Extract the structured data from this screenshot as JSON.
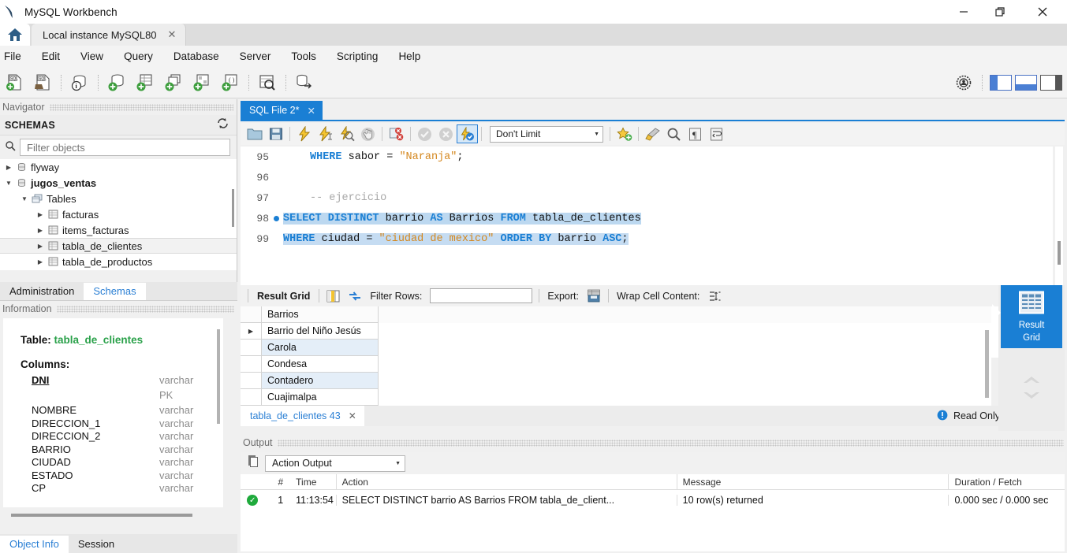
{
  "window": {
    "title": "MySQL Workbench",
    "minimize": "—",
    "maximize": "❐",
    "close": "✕"
  },
  "connection_tab": {
    "label": "Local instance MySQL80",
    "close": "✕"
  },
  "menu": [
    "File",
    "Edit",
    "View",
    "Query",
    "Database",
    "Server",
    "Tools",
    "Scripting",
    "Help"
  ],
  "main_toolbar": {
    "icons": [
      "new-sql-tab-icon",
      "open-sql-script-icon",
      "server-status-icon",
      "new-schema-icon",
      "new-table-icon",
      "new-view-icon",
      "new-procedure-icon",
      "new-function-icon",
      "search-data-icon",
      "reconnect-server-icon"
    ],
    "right_icons": [
      "admin-target-icon",
      "sidebar-left-toggle",
      "sidebar-bottom-toggle",
      "sidebar-right-toggle"
    ]
  },
  "navigator": {
    "caption": "Navigator",
    "schemas_header": "SCHEMAS",
    "refresh_icon": "refresh-icon",
    "filter": {
      "placeholder": "Filter objects",
      "value": "",
      "icon": "search-icon"
    },
    "tree": [
      {
        "label": "flyway",
        "indent": 0,
        "expanded": false,
        "icon": "schema-icon",
        "bold": false,
        "selected": false
      },
      {
        "label": "jugos_ventas",
        "indent": 0,
        "expanded": true,
        "icon": "schema-icon",
        "bold": true,
        "selected": false
      },
      {
        "label": "Tables",
        "indent": 1,
        "expanded": true,
        "icon": "tables-icon",
        "bold": false,
        "selected": false
      },
      {
        "label": "facturas",
        "indent": 2,
        "expanded": false,
        "icon": "table-icon",
        "bold": false,
        "selected": false
      },
      {
        "label": "items_facturas",
        "indent": 2,
        "expanded": false,
        "icon": "table-icon",
        "bold": false,
        "selected": false
      },
      {
        "label": "tabla_de_clientes",
        "indent": 2,
        "expanded": false,
        "icon": "table-icon",
        "bold": false,
        "selected": true
      },
      {
        "label": "tabla_de_productos",
        "indent": 2,
        "expanded": false,
        "icon": "table-icon",
        "bold": false,
        "selected": false
      }
    ],
    "tabs": [
      {
        "label": "Administration",
        "active": false
      },
      {
        "label": "Schemas",
        "active": true
      }
    ]
  },
  "information": {
    "caption": "Information",
    "table_label": "Table:",
    "table_name": "tabla_de_clientes",
    "columns_label": "Columns:",
    "columns": [
      {
        "name": "DNI",
        "type": "varchar",
        "pk": true,
        "extra": "PK"
      },
      {
        "name": "NOMBRE",
        "type": "varchar",
        "pk": false,
        "extra": ""
      },
      {
        "name": "DIRECCION_1",
        "type": "varchar",
        "pk": false,
        "extra": ""
      },
      {
        "name": "DIRECCION_2",
        "type": "varchar",
        "pk": false,
        "extra": ""
      },
      {
        "name": "BARRIO",
        "type": "varchar",
        "pk": false,
        "extra": ""
      },
      {
        "name": "CIUDAD",
        "type": "varchar",
        "pk": false,
        "extra": ""
      },
      {
        "name": "ESTADO",
        "type": "varchar",
        "pk": false,
        "extra": ""
      },
      {
        "name": "CP",
        "type": "varchar",
        "pk": false,
        "extra": ""
      }
    ],
    "tabs": [
      {
        "label": "Object Info",
        "active": true
      },
      {
        "label": "Session",
        "active": false
      }
    ]
  },
  "sql_editor": {
    "tab_label": "SQL File 2*",
    "tab_close": "✕",
    "toolbar": {
      "icons": [
        "open-script-icon",
        "save-script-icon",
        "execute-all-icon",
        "execute-current-icon",
        "explain-icon",
        "stop-icon",
        "toggle-stop-on-error-icon",
        "commit-icon",
        "rollback-icon",
        "autocommit-icon"
      ],
      "limit_value": "Don't Limit",
      "right_icons": [
        "snippet-save-icon",
        "beautify-icon",
        "find-icon",
        "invisible-chars-icon",
        "wrap-lines-icon"
      ]
    },
    "lines": [
      {
        "number": "95",
        "breakpoint": false,
        "highlighted": false,
        "tokens": [
          {
            "t": "    ",
            "c": "plain"
          },
          {
            "t": "WHERE",
            "c": "k"
          },
          {
            "t": " sabor = ",
            "c": "id"
          },
          {
            "t": "\"Naranja\"",
            "c": "str"
          },
          {
            "t": ";",
            "c": "op"
          }
        ]
      },
      {
        "number": "96",
        "breakpoint": false,
        "highlighted": false,
        "tokens": []
      },
      {
        "number": "97",
        "breakpoint": false,
        "highlighted": false,
        "tokens": [
          {
            "t": "    ",
            "c": "plain"
          },
          {
            "t": "-- ejercicio",
            "c": "cmt"
          }
        ]
      },
      {
        "number": "98",
        "breakpoint": true,
        "highlighted": true,
        "tokens": [
          {
            "t": "SELECT DISTINCT",
            "c": "k"
          },
          {
            "t": " barrio ",
            "c": "id"
          },
          {
            "t": "AS",
            "c": "k"
          },
          {
            "t": " Barrios ",
            "c": "id"
          },
          {
            "t": "FROM",
            "c": "k"
          },
          {
            "t": " tabla_de_clientes",
            "c": "id"
          }
        ]
      },
      {
        "number": "99",
        "breakpoint": false,
        "highlighted": true,
        "tokens": [
          {
            "t": "WHERE",
            "c": "k"
          },
          {
            "t": " ciudad = ",
            "c": "id"
          },
          {
            "t": "\"ciudad de mexico\"",
            "c": "str"
          },
          {
            "t": " ",
            "c": "id"
          },
          {
            "t": "ORDER BY",
            "c": "k"
          },
          {
            "t": " barrio ",
            "c": "id"
          },
          {
            "t": "ASC",
            "c": "k"
          },
          {
            "t": ";",
            "c": "op"
          }
        ]
      }
    ]
  },
  "result_grid": {
    "toolbar": {
      "title": "Result Grid",
      "grid-view-icon": "grid-view-icon",
      "refresh-icon": "refresh-icon",
      "filter_rows_label": "Filter Rows:",
      "filter_rows_value": "",
      "export_label": "Export:",
      "export-icon": "export-icon",
      "wrap_label": "Wrap Cell Content:",
      "wrap-icon": "wrap-cell-icon"
    },
    "columns": [
      "Barrios"
    ],
    "rows": [
      {
        "marker": "▶",
        "values": [
          "Barrio del Niño Jesús"
        ]
      },
      {
        "marker": "",
        "values": [
          "Carola"
        ]
      },
      {
        "marker": "",
        "values": [
          "Condesa"
        ]
      },
      {
        "marker": "",
        "values": [
          "Contadero"
        ]
      },
      {
        "marker": "",
        "values": [
          "Cuajimalpa"
        ]
      }
    ],
    "result_tab": {
      "label": "tabla_de_clientes 43",
      "close": "✕"
    },
    "read_only": "Read Only",
    "side_button": {
      "line1": "Result",
      "line2": "Grid",
      "icon": "result-grid-icon"
    }
  },
  "output": {
    "caption": "Output",
    "selector_value": "Action Output",
    "copy_icon": "copy-icon",
    "columns": [
      "#",
      "Time",
      "Action",
      "Message",
      "Duration / Fetch"
    ],
    "rows": [
      {
        "status": "success",
        "num": "1",
        "time": "11:13:54",
        "action": "SELECT DISTINCT barrio AS Barrios FROM tabla_de_client...",
        "message": "10 row(s) returned",
        "duration": "0.000 sec / 0.000 sec"
      }
    ]
  },
  "colors": {
    "accent": "#1a7fd4",
    "keyword": "#1a7fd4",
    "string": "#d4871e",
    "comment": "#a8a8a8",
    "schema_green": "#2aa14a",
    "success": "#1faa3c",
    "selection": "#bcd8f0"
  }
}
